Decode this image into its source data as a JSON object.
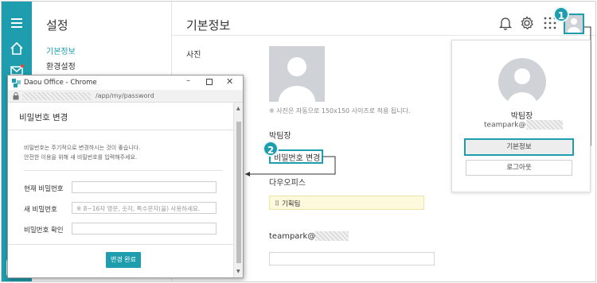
{
  "sidebar": {
    "title": "설정",
    "items": [
      {
        "label": "기본정보",
        "active": true
      },
      {
        "label": "환경설정",
        "active": false
      }
    ]
  },
  "main": {
    "title": "기본정보",
    "photo_label": "사진",
    "photo_note": "※ 사진은 자동으로 150x150 사이즈로 적용 됩니다.",
    "name_value": "박팀장",
    "change_password_link": "비밀번호 변경",
    "company_label": "다우오피스",
    "team_value": "기획팀",
    "email_prefix": "teampark@"
  },
  "profile_card": {
    "name": "박팀장",
    "id_prefix": "teampark@",
    "basic_info_button": "기본정보",
    "logout_button": "로그아웃"
  },
  "steps": {
    "one": "1",
    "two": "2"
  },
  "popup_window": {
    "title": "Daou Office - Chrome",
    "url": "/app/my/password",
    "heading": "비밀번호 변경",
    "desc_line1": "비밀번호는 주기적으로 변경하시는 것이 좋습니다.",
    "desc_line2": "안전한 이용을 위해 새 비밀번호를 입력해주세요.",
    "current_label": "현재 비밀번호",
    "new_label": "새 비밀번호",
    "new_placeholder": "※ 8~16자 영문, 숫자, 특수문자(을) 사용하세요.",
    "confirm_label": "비밀번호 확인",
    "submit_button": "변경 완료"
  },
  "colors": {
    "accent": "#1e9dae",
    "notify_dot": "#e64a3b"
  },
  "icons": [
    "menu-icon",
    "home-icon",
    "mail-icon",
    "bell-icon",
    "gear-icon",
    "apps-grid-icon",
    "user-avatar-icon"
  ]
}
